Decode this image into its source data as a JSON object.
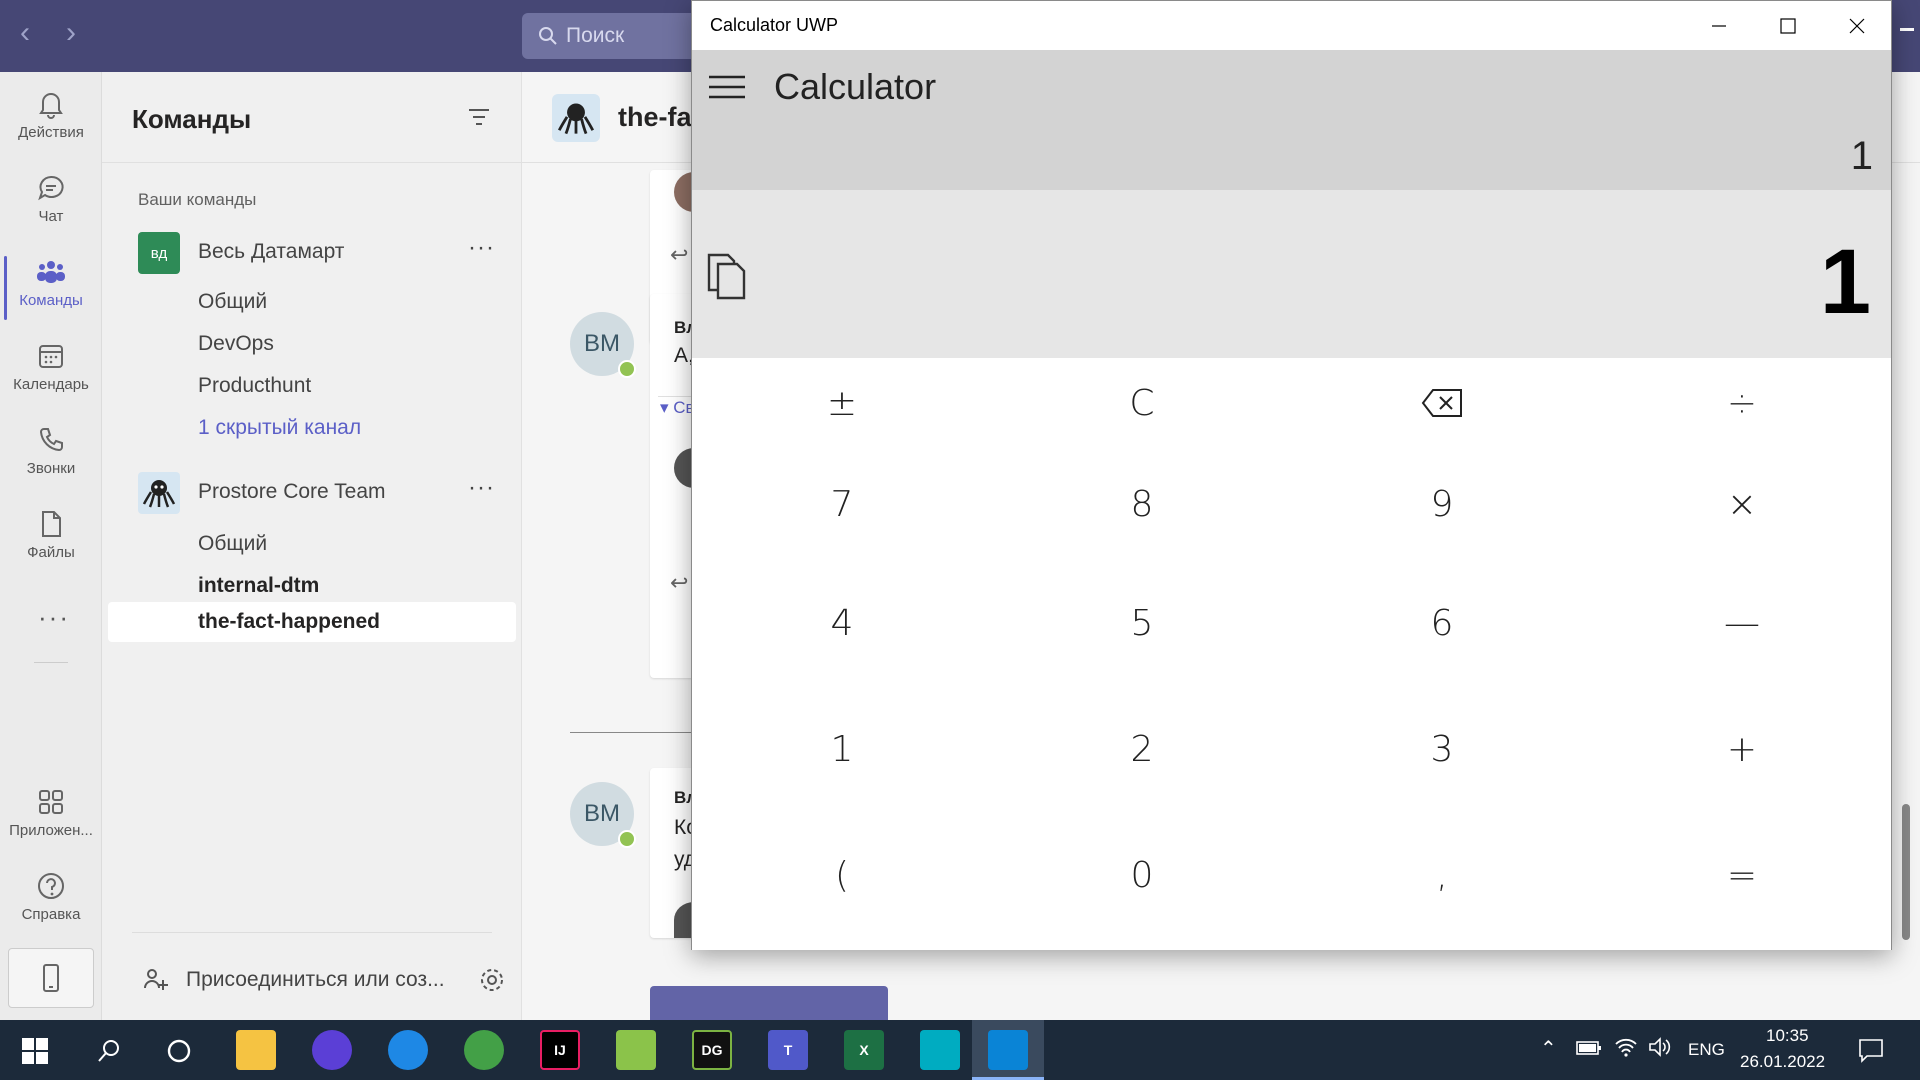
{
  "teams": {
    "search_placeholder": "Поиск",
    "rail": [
      {
        "label": "Действия",
        "icon": "bell-icon"
      },
      {
        "label": "Чат",
        "icon": "chat-icon"
      },
      {
        "label": "Команды",
        "icon": "teams-icon"
      },
      {
        "label": "Календарь",
        "icon": "calendar-icon"
      },
      {
        "label": "Звонки",
        "icon": "phone-icon"
      },
      {
        "label": "Файлы",
        "icon": "file-icon"
      },
      {
        "label": "Приложен...",
        "icon": "apps-icon"
      },
      {
        "label": "Справка",
        "icon": "help-icon"
      }
    ],
    "panel_title": "Команды",
    "section_label": "Ваши команды",
    "teams_list": [
      {
        "name": "Весь Датамарт",
        "avatar_text": "вд",
        "channels": [
          "Общий",
          "DevOps",
          "Producthunt",
          "1 скрытый канал"
        ]
      },
      {
        "name": "Prostore Core Team",
        "channels": [
          "Общий",
          "internal-dtm",
          "the-fact-happened"
        ]
      }
    ],
    "join_label": "Присоединиться или соз...",
    "channel_header": "the-fa",
    "avatar_initials": "ВМ",
    "msg1_author": "Вл",
    "msg1_text": "А,",
    "msg1_link": "Св",
    "msg2_author": "Вл",
    "msg2_text1": "Ко",
    "msg2_text2": "уд"
  },
  "calculator": {
    "window_title": "Calculator UWP",
    "app_name": "Calculator",
    "expression": "1",
    "result": "1",
    "keys": [
      [
        "±",
        "C",
        "⌫",
        "÷"
      ],
      [
        "7",
        "8",
        "9",
        "×"
      ],
      [
        "4",
        "5",
        "6",
        "—"
      ],
      [
        "1",
        "2",
        "3",
        "+"
      ],
      [
        "(",
        "0",
        ",",
        "="
      ]
    ]
  },
  "taskbar": {
    "lang": "ENG",
    "time": "10:35",
    "date": "26.01.2022"
  },
  "colors": {
    "teams_purple": "#464775",
    "accent": "#5b5fc7",
    "calc_header": "#d3d3d3",
    "calc_display": "#e6e6e6",
    "taskbar": "#1c2a3a"
  }
}
